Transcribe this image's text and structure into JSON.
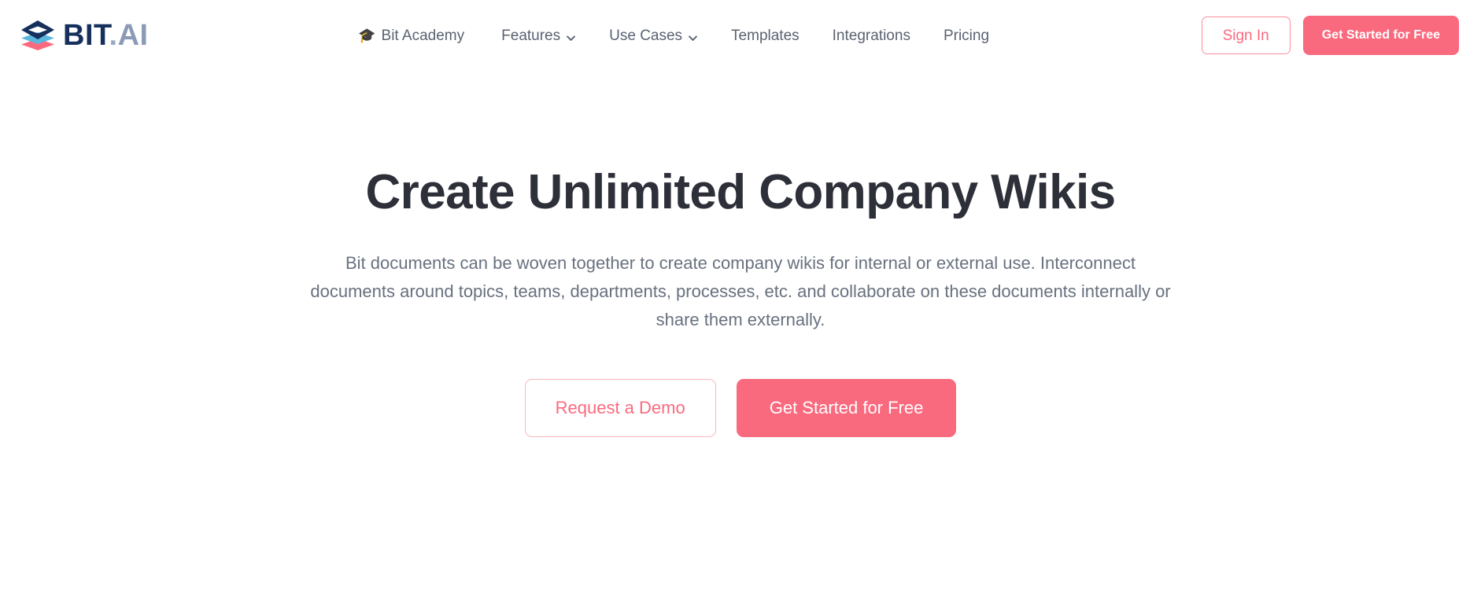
{
  "brand": {
    "logo_icon": "stacked-layers-logo-icon",
    "name_primary": "BIT",
    "name_dot": ".",
    "name_secondary": "AI"
  },
  "nav": {
    "items": [
      {
        "label": "Bit Academy",
        "icon": "graduation-cap-icon",
        "has_caret": false
      },
      {
        "label": "Features",
        "icon": null,
        "has_caret": true
      },
      {
        "label": "Use Cases",
        "icon": null,
        "has_caret": true
      },
      {
        "label": "Templates",
        "icon": null,
        "has_caret": false
      },
      {
        "label": "Integrations",
        "icon": null,
        "has_caret": false
      },
      {
        "label": "Pricing",
        "icon": null,
        "has_caret": false
      }
    ]
  },
  "header_actions": {
    "sign_in_label": "Sign In",
    "get_started_label": "Get Started for Free"
  },
  "hero": {
    "title": "Create Unlimited Company Wikis",
    "subtitle": "Bit documents can be woven together to create company wikis for internal or external use. Interconnect documents around topics, teams, departments, processes, etc. and collaborate on these documents internally or share them externally.",
    "cta_secondary_label": "Request a Demo",
    "cta_primary_label": "Get Started for Free"
  },
  "colors": {
    "accent": "#fa6a7e",
    "accent_border": "#fbb7c0",
    "brand_navy": "#15305c",
    "brand_slate": "#8b9ab5",
    "brand_light_blue": "#5bb7dd",
    "heading": "#2d3039",
    "body_text": "#68717f",
    "nav_text": "#5a6372",
    "background": "#ffffff"
  }
}
